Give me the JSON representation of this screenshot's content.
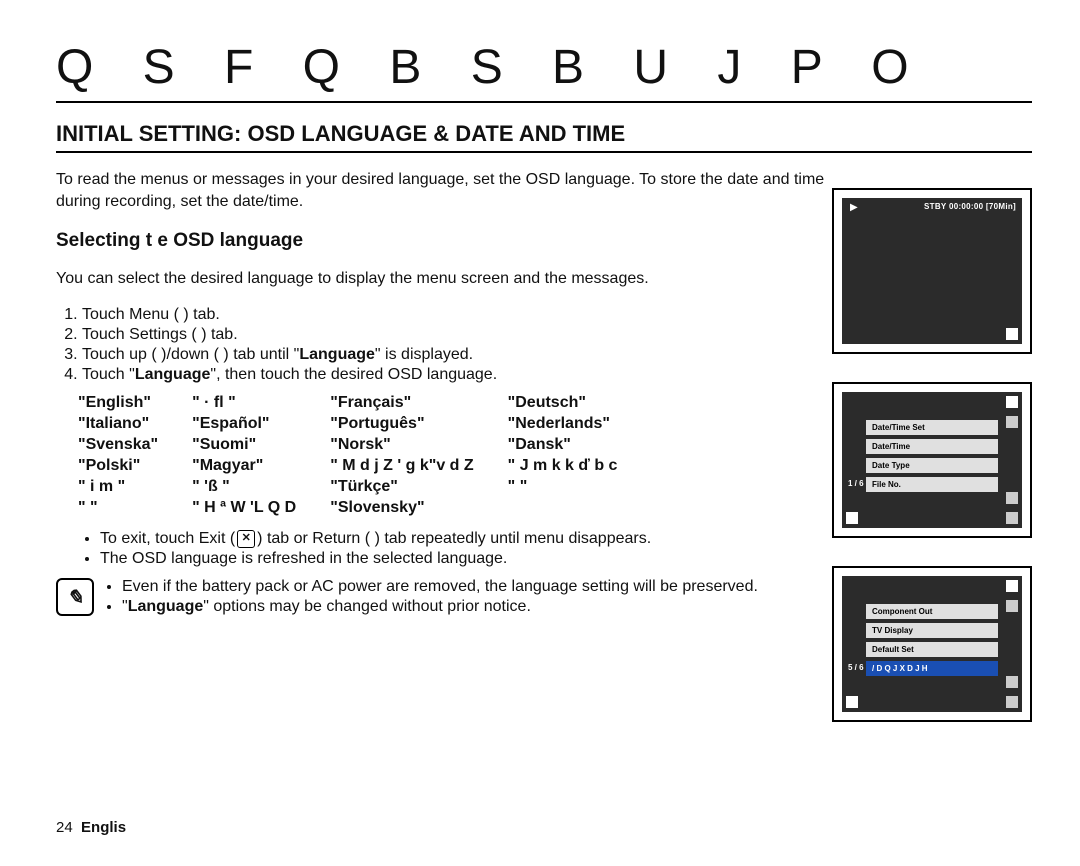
{
  "header": {
    "big_title": "Q S F Q B S B U J P O",
    "section_title": "INITIAL SETTING: OSD LANGUAGE & DATE AND TIME",
    "intro": "To read the menus or messages in your desired language, set the OSD language. To store the date and time during recording, set the date/time."
  },
  "subhead": "Selecting t    e OSD language",
  "subhead_desc": "You can select the desired language to display the menu screen and the messages.",
  "steps": {
    "s1_a": "Touch Menu (",
    "s1_b": ") tab.",
    "s2_a": "Touch Settings (",
    "s2_b": ") tab.",
    "s3_a": "Touch up (",
    "s3_b": ")/down (",
    "s3_c": ") tab until \"",
    "s3_d": "Language",
    "s3_e": "\" is displayed.",
    "s4_a": "Touch \"",
    "s4_b": "Language",
    "s4_c": "\", then touch the desired OSD language."
  },
  "languages": [
    [
      "\"English\"",
      "\"   · ﬂ    \"",
      "\"Français\"",
      "\"Deutsch\""
    ],
    [
      "\"Italiano\"",
      "\"Español\"",
      "\"Português\"",
      "\"Nederlands\""
    ],
    [
      "\"Svenska\"",
      "\"Suomi\"",
      "\"Norsk\"",
      "\"Dansk\""
    ],
    [
      "\"Polski\"",
      "\"Magyar\"",
      "\" M d j Z ' g k\"v d Z",
      "\" J m k k ď b c"
    ],
    [
      "\"   i m    \"",
      "\"      'ß    \"",
      "\"Türkçe\"",
      "\"           \""
    ],
    [
      "\"           \"",
      "\"   H ª W 'L Q D",
      "\"Slovensky\"",
      ""
    ]
  ],
  "bullets": {
    "exit_a": "To exit, touch Exit (",
    "exit_b": ") tab or Return (",
    "exit_c": ") tab repeatedly until menu disappears.",
    "refresh": "The OSD language is refreshed in the selected language."
  },
  "notes": {
    "n1": "Even if the battery pack or AC power are removed, the language setting will be preserved.",
    "n2_a": "\"",
    "n2_b": "Language",
    "n2_c": "\" options may be changed without prior notice."
  },
  "footer": {
    "page_num": "24",
    "lang": "Englis"
  },
  "screen1": {
    "status": "STBY 00:00:00 [70Min]"
  },
  "screen2": {
    "pager": "1 / 6",
    "items": [
      "Date/Time Set",
      "Date/Time",
      "Date Type",
      "File No."
    ]
  },
  "screen3": {
    "pager": "5 / 6",
    "items": [
      "Component Out",
      "TV Display",
      "Default Set",
      "/ D Q J X D J H"
    ],
    "active_index": 3
  },
  "exit_icon_glyph": "✕"
}
